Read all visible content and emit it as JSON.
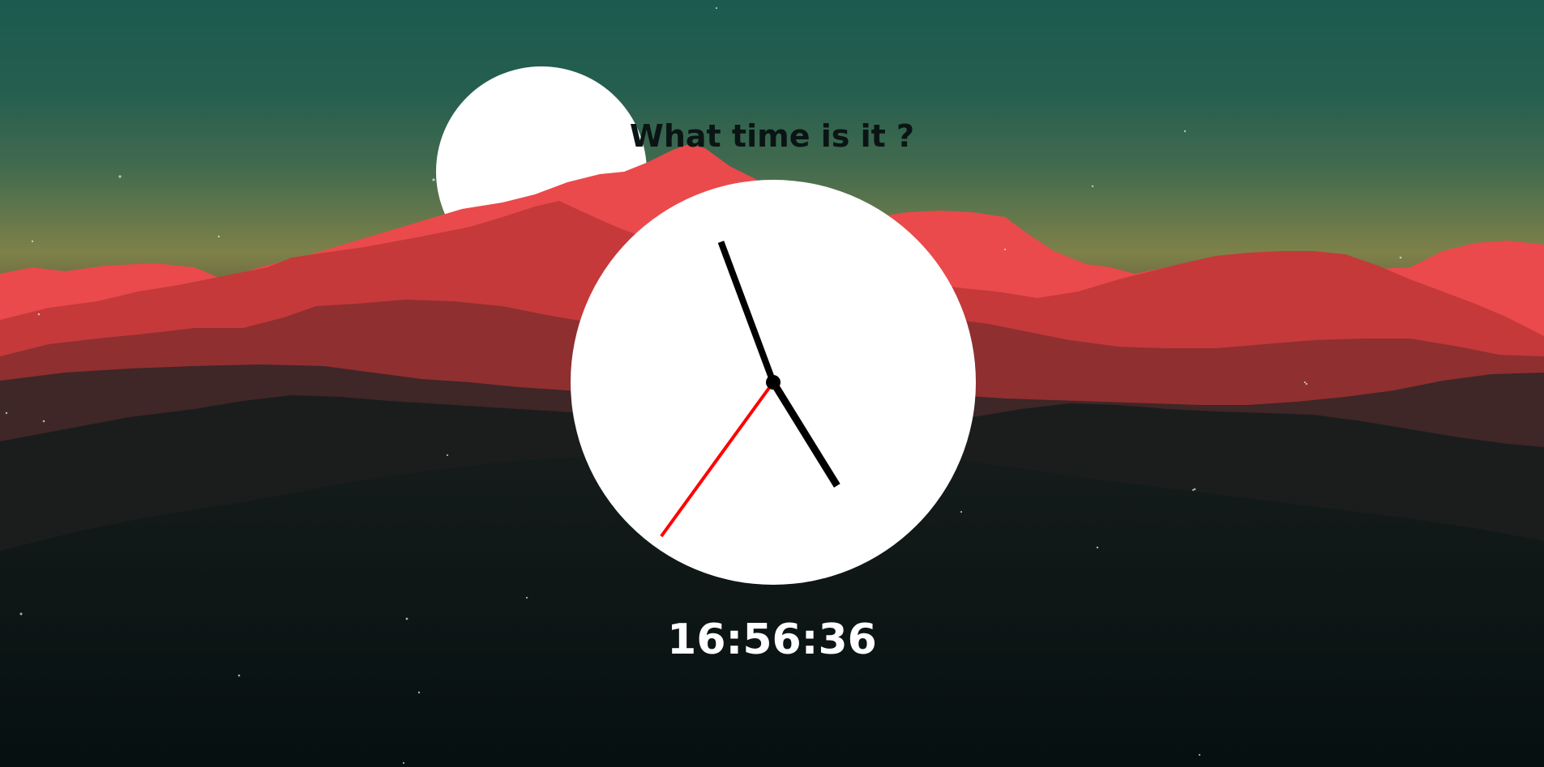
{
  "title": "What time is it ?",
  "digital_time": "16:56:36",
  "clock": {
    "hour": 16,
    "minute": 56,
    "second": 36
  },
  "colors": {
    "sky_top": "#1d5a4f",
    "sky_horizon": "#8a8a4a",
    "sun": "#ffffff",
    "mountain_far": "#ea4a4a",
    "mountain_mid": "#c23a3a",
    "mountain_dark": "#3e2626",
    "ground": "#0c1818",
    "clock_face": "#ffffff",
    "hand": "#000000",
    "second_hand": "#ff0000",
    "title_text": "#0b1414",
    "digital_text": "#ffffff"
  }
}
